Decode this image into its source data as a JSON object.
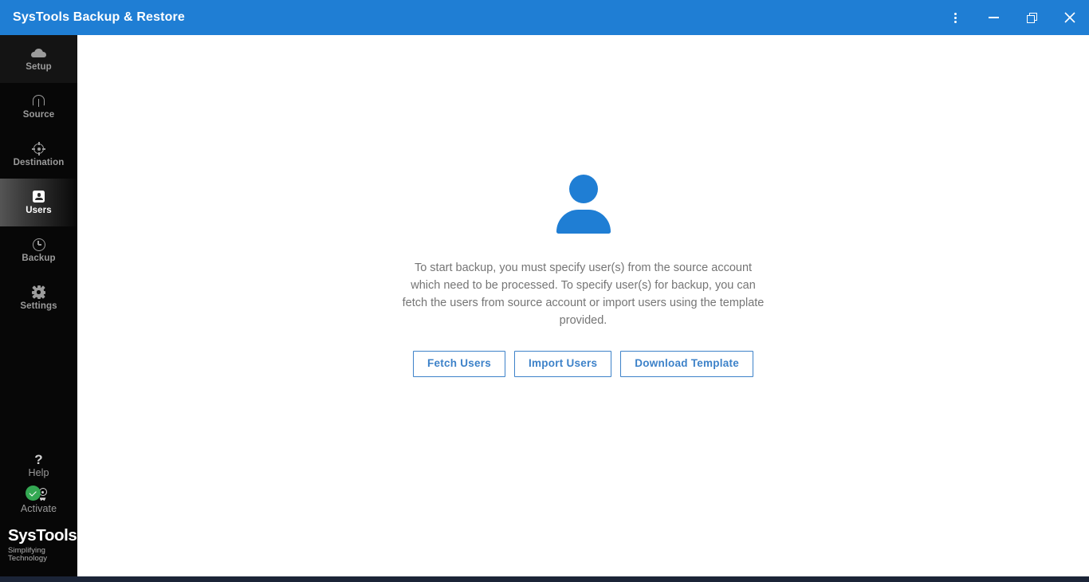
{
  "window": {
    "title": "SysTools Backup & Restore",
    "accent_color": "#1f7ed4",
    "controls": {
      "menu": "More options",
      "minimize": "Minimize",
      "restore": "Restore",
      "close": "Close"
    }
  },
  "sidebar": {
    "background_color": "#070707",
    "items": [
      {
        "label": "Setup",
        "icon": "cloud-icon",
        "state": "setup"
      },
      {
        "label": "Source",
        "icon": "source-icon",
        "state": "default"
      },
      {
        "label": "Destination",
        "icon": "destination-icon",
        "state": "default"
      },
      {
        "label": "Users",
        "icon": "users-icon",
        "state": "active"
      },
      {
        "label": "Backup",
        "icon": "clock-icon",
        "state": "default"
      },
      {
        "label": "Settings",
        "icon": "gear-icon",
        "state": "default"
      }
    ],
    "utilities": [
      {
        "label": "Help",
        "icon": "question-mark-icon"
      },
      {
        "label": "Activate",
        "icon": "award-icon",
        "badge": "check-badge",
        "badge_color": "#34a853"
      }
    ],
    "logo": {
      "name": "SysTools",
      "registered": "®",
      "tagline": "Simplifying Technology"
    }
  },
  "main": {
    "illustration": "user-avatar-illustration",
    "illustration_color": "#1f7ed4",
    "description": "To start backup, you must specify user(s) from the source account which need to be processed. To specify user(s) for backup, you can fetch the users from source account or import users using the template provided.",
    "buttons": [
      {
        "label": "Fetch Users",
        "name": "fetch-users-button"
      },
      {
        "label": "Import Users",
        "name": "import-users-button"
      },
      {
        "label": "Download Template",
        "name": "download-template-button"
      }
    ],
    "button_color": "#3d82c9"
  }
}
